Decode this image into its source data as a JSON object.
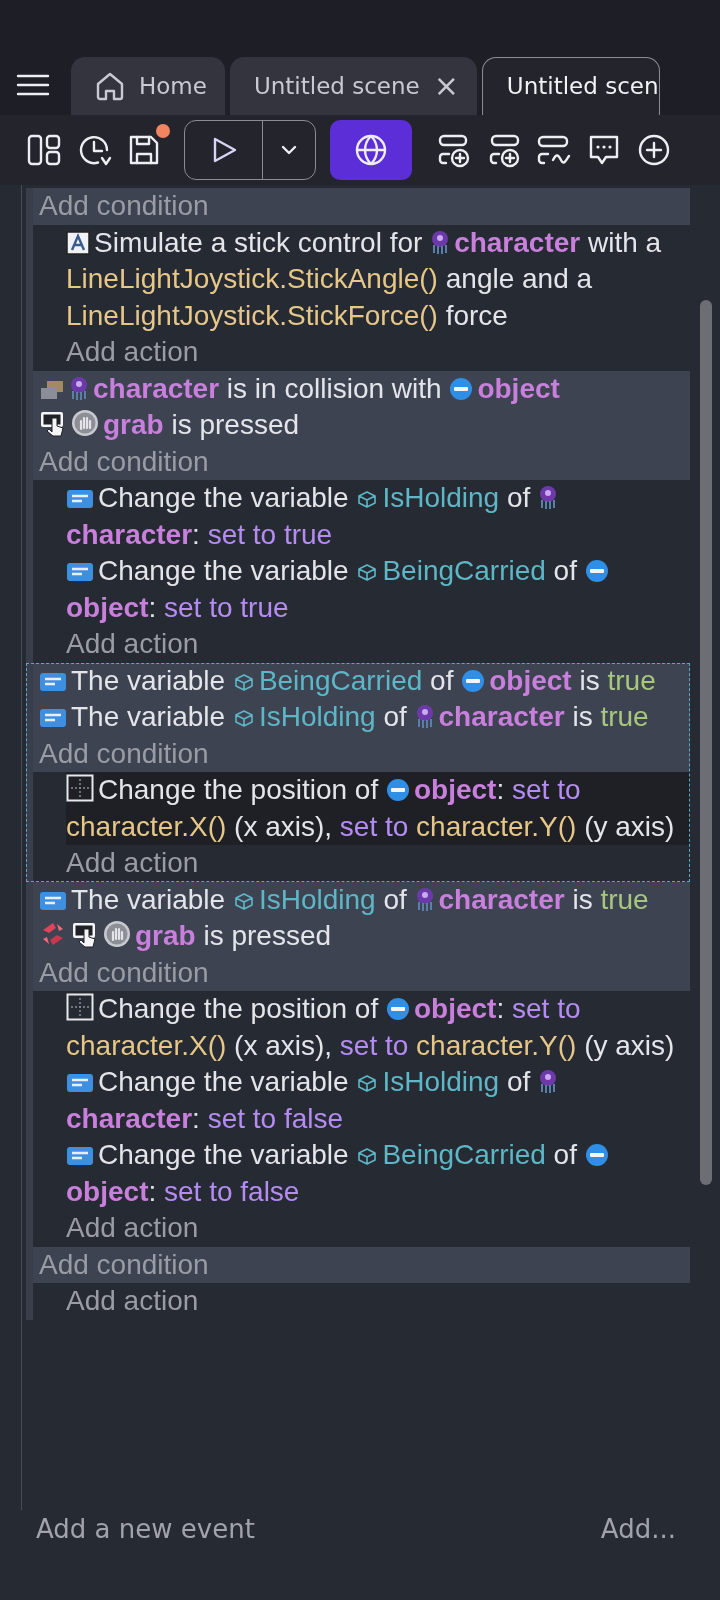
{
  "tabs": [
    {
      "label": "Home",
      "kind": "home",
      "selected": false
    },
    {
      "label": "Untitled scene",
      "kind": "scene",
      "close": "×",
      "selected": false
    },
    {
      "label": "Untitled scen",
      "kind": "scene",
      "selected": true
    }
  ],
  "toolbar": {
    "unsaved": true
  },
  "events": [
    {
      "selected": false,
      "add_condition": "Add condition",
      "actions": [
        {
          "kind": "text",
          "selected": false,
          "segments": [
            {
              "t": "Simulate a stick control for "
            },
            {
              "kind": "sprite",
              "t": "character"
            },
            {
              "t": " with a "
            },
            {
              "kind": "expr",
              "t": "LineLightJoystick.StickAngle()"
            },
            {
              "t": " angle and a "
            },
            {
              "kind": "expr",
              "t": "LineLightJoystick.StickForce()"
            },
            {
              "t": " force"
            }
          ]
        }
      ],
      "add_action": "Add action"
    },
    {
      "selected": false,
      "conditions": [
        {
          "kind": "collision",
          "inverted": false,
          "segments": [
            {
              "kind": "sprite",
              "t": "character"
            },
            {
              "t": " is in collision with "
            },
            {
              "kind": "button",
              "t": "object"
            }
          ]
        },
        {
          "kind": "input",
          "inverted": false,
          "segments": [
            {
              "kind": "input",
              "t": "grab"
            },
            {
              "t": " is pressed"
            }
          ]
        }
      ],
      "add_condition": "Add condition",
      "actions": [
        {
          "kind": "variable",
          "selected": false,
          "segments": [
            {
              "t": "Change the variable "
            },
            {
              "kind": "variable",
              "t": "IsHolding"
            },
            {
              "t": " of "
            },
            {
              "kind": "sprite",
              "t": "character"
            },
            {
              "t": ": "
            },
            {
              "kind": "op",
              "t": "set to true"
            }
          ]
        },
        {
          "kind": "variable",
          "selected": false,
          "segments": [
            {
              "t": "Change the variable "
            },
            {
              "kind": "variable",
              "t": "BeingCarried"
            },
            {
              "t": " of "
            },
            {
              "kind": "button",
              "t": "object"
            },
            {
              "t": ": "
            },
            {
              "kind": "op",
              "t": "set to true"
            }
          ]
        }
      ],
      "add_action": "Add action"
    },
    {
      "selected": true,
      "conditions": [
        {
          "kind": "variable",
          "inverted": false,
          "segments": [
            {
              "t": "The variable "
            },
            {
              "kind": "variable",
              "t": "BeingCarried"
            },
            {
              "t": " of "
            },
            {
              "kind": "button",
              "t": "object"
            },
            {
              "t": " is "
            },
            {
              "kind": "bool",
              "t": "true"
            }
          ]
        },
        {
          "kind": "variable",
          "inverted": false,
          "segments": [
            {
              "t": "The variable "
            },
            {
              "kind": "variable",
              "t": "IsHolding"
            },
            {
              "t": " of "
            },
            {
              "kind": "sprite",
              "t": "character"
            },
            {
              "t": " is "
            },
            {
              "kind": "bool",
              "t": "true"
            }
          ]
        }
      ],
      "add_condition": "Add condition",
      "actions": [
        {
          "kind": "position",
          "selected": true,
          "segments": [
            {
              "t": "Change the position of "
            },
            {
              "kind": "button",
              "t": "object"
            },
            {
              "t": ": "
            },
            {
              "kind": "op",
              "t": "set to"
            },
            {
              "kind": "expr",
              "t": "character.X()"
            },
            {
              "t": " (x axis), "
            },
            {
              "kind": "op",
              "t": "set to"
            },
            {
              "kind": "expr",
              "t": "character.Y()"
            },
            {
              "t": " (y axis)"
            }
          ]
        }
      ],
      "add_action": "Add action"
    },
    {
      "selected": false,
      "conditions": [
        {
          "kind": "variable",
          "inverted": false,
          "segments": [
            {
              "t": "The variable "
            },
            {
              "kind": "variable",
              "t": "IsHolding"
            },
            {
              "t": " of "
            },
            {
              "kind": "sprite",
              "t": "character"
            },
            {
              "t": " is "
            },
            {
              "kind": "bool",
              "t": "true"
            }
          ]
        },
        {
          "kind": "input",
          "inverted": true,
          "segments": [
            {
              "kind": "input",
              "t": "grab"
            },
            {
              "t": " is pressed"
            }
          ]
        }
      ],
      "add_condition": "Add condition",
      "actions": [
        {
          "kind": "position",
          "selected": false,
          "segments": [
            {
              "t": "Change the position of "
            },
            {
              "kind": "button",
              "t": "object"
            },
            {
              "t": ": "
            },
            {
              "kind": "op",
              "t": "set to"
            },
            {
              "kind": "expr",
              "t": "character.X()"
            },
            {
              "t": " (x axis), "
            },
            {
              "kind": "op",
              "t": "set to"
            },
            {
              "kind": "expr",
              "t": "character.Y()"
            },
            {
              "t": " (y axis)"
            }
          ]
        },
        {
          "kind": "variable",
          "selected": false,
          "segments": [
            {
              "t": "Change the variable "
            },
            {
              "kind": "variable",
              "t": "IsHolding"
            },
            {
              "t": " of "
            },
            {
              "kind": "sprite",
              "t": "character"
            },
            {
              "t": ": "
            },
            {
              "kind": "op",
              "t": "set to false"
            }
          ]
        },
        {
          "kind": "variable",
          "selected": false,
          "segments": [
            {
              "t": "Change the variable "
            },
            {
              "kind": "variable",
              "t": "BeingCarried"
            },
            {
              "t": " of "
            },
            {
              "kind": "button",
              "t": "object"
            },
            {
              "t": ": "
            },
            {
              "kind": "op",
              "t": "set to false"
            }
          ]
        }
      ],
      "add_action": "Add action"
    },
    {
      "selected": false,
      "add_condition": "Add condition",
      "add_action": "Add action"
    }
  ],
  "footer": {
    "add_event": "Add a new event",
    "add_more": "Add..."
  }
}
